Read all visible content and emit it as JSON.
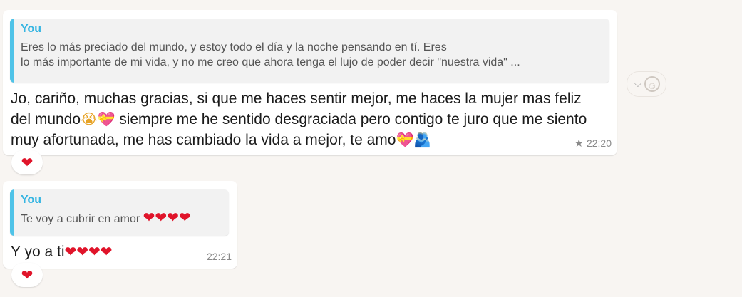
{
  "messages": [
    {
      "quote": {
        "author": "You",
        "text": "Eres lo más preciado del mundo, y estoy todo el día y la noche pensando en tí. Eres\nlo más importante de mi vida, y no me creo que ahora tenga el lujo de poder decir \"nuestra vida\" ..."
      },
      "text_a": "Jo, cariño, muchas gracias, si que me haces sentir mejor, me haces la mujer mas feliz del mundo",
      "text_b": " siempre me he sentido desgraciada pero contigo te juro que me siento muy afortunada, me has cambiado la vida a mejor, te amo",
      "time": "22:20",
      "starred": true,
      "reaction": "heart"
    },
    {
      "quote": {
        "author": "You",
        "text": "Te voy a cubrir en amor "
      },
      "text": "Y yo a ti",
      "time": "22:21",
      "reaction": "heart"
    }
  ],
  "icons": {
    "star": "star-icon",
    "heart": "heart-icon",
    "chevron": "chevron-down-icon",
    "emoji": "smiley-icon"
  },
  "colors": {
    "background": "#f8f5f2",
    "quote_bar": "#4fc3e8",
    "quote_author": "#35b5e2",
    "heart": "#e0142a"
  }
}
